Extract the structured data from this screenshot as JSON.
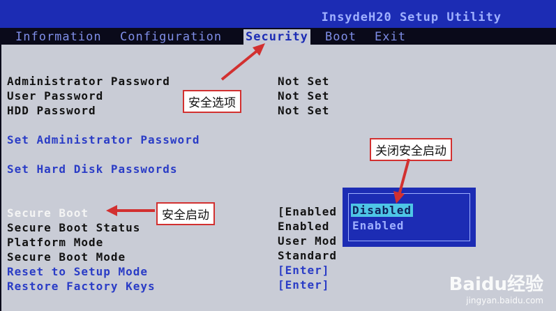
{
  "window": {
    "title": "InsydeH20 Setup Utility"
  },
  "tabs": [
    "Information",
    "Configuration",
    "Security",
    "Boot",
    "Exit"
  ],
  "active_tab": "Security",
  "settings": [
    {
      "label": "Administrator Password",
      "value": "Not Set"
    },
    {
      "label": "User Password",
      "value": "Not Set"
    },
    {
      "label": "HDD Password",
      "value": "Not Set"
    },
    {
      "label": "Set Administrator Password",
      "value": ""
    },
    {
      "label": "Set Hard Disk Passwords",
      "value": ""
    },
    {
      "label": "Secure Boot",
      "value": "[Enabled"
    },
    {
      "label": "Secure Boot Status",
      "value": "Enabled"
    },
    {
      "label": "Platform Mode",
      "value": "User Mod"
    },
    {
      "label": "Secure Boot Mode",
      "value": "Standard"
    },
    {
      "label": "Reset to Setup Mode",
      "value": "[Enter]"
    },
    {
      "label": "Restore Factory Keys",
      "value": "[Enter]"
    }
  ],
  "popup": {
    "options": [
      "Disabled",
      "Enabled"
    ],
    "selected": "Disabled"
  },
  "annotations": {
    "security_tab": "安全选项",
    "disable_secure_boot": "关闭安全启动",
    "secure_boot": "安全启动"
  },
  "watermark": {
    "logo": "Baidu经验",
    "url": "jingyan.baidu.com"
  },
  "colors": {
    "header_bg": "#1c2cb4",
    "panel_bg": "#c9ccd6",
    "link": "#2a3cc6",
    "callout_border": "#d23030",
    "selection": "#4ec6e6"
  }
}
